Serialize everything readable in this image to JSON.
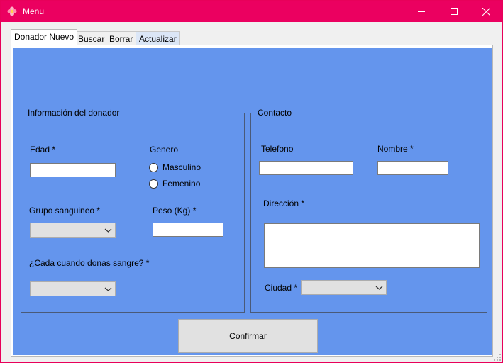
{
  "window": {
    "title": "Menu",
    "icon": "flower-icon",
    "accent_color": "#eb0060"
  },
  "tabs": [
    {
      "label": "Donador Nuevo",
      "active": true
    },
    {
      "label": "Buscar",
      "active": false
    },
    {
      "label": "Borrar",
      "active": false
    },
    {
      "label": "Actualizar",
      "active": false
    }
  ],
  "panel_color": "#6495ed",
  "info": {
    "title": "Información del donador",
    "edad_label": "Edad *",
    "edad_value": "",
    "genero_label": "Genero",
    "genero_options": [
      "Masculino",
      "Femenino"
    ],
    "grupo_label": "Grupo sanguineo *",
    "grupo_value": "",
    "peso_label": "Peso (Kg) *",
    "peso_value": "",
    "frecuencia_label": "¿Cada cuando donas sangre? *",
    "frecuencia_value": ""
  },
  "contacto": {
    "title": "Contacto",
    "telefono_label": "Telefono",
    "telefono_value": "",
    "nombre_label": "Nombre *",
    "nombre_value": "",
    "direccion_label": "Dirección *",
    "direccion_value": "",
    "ciudad_label": "Ciudad *",
    "ciudad_value": ""
  },
  "confirm_label": "Confirmar"
}
